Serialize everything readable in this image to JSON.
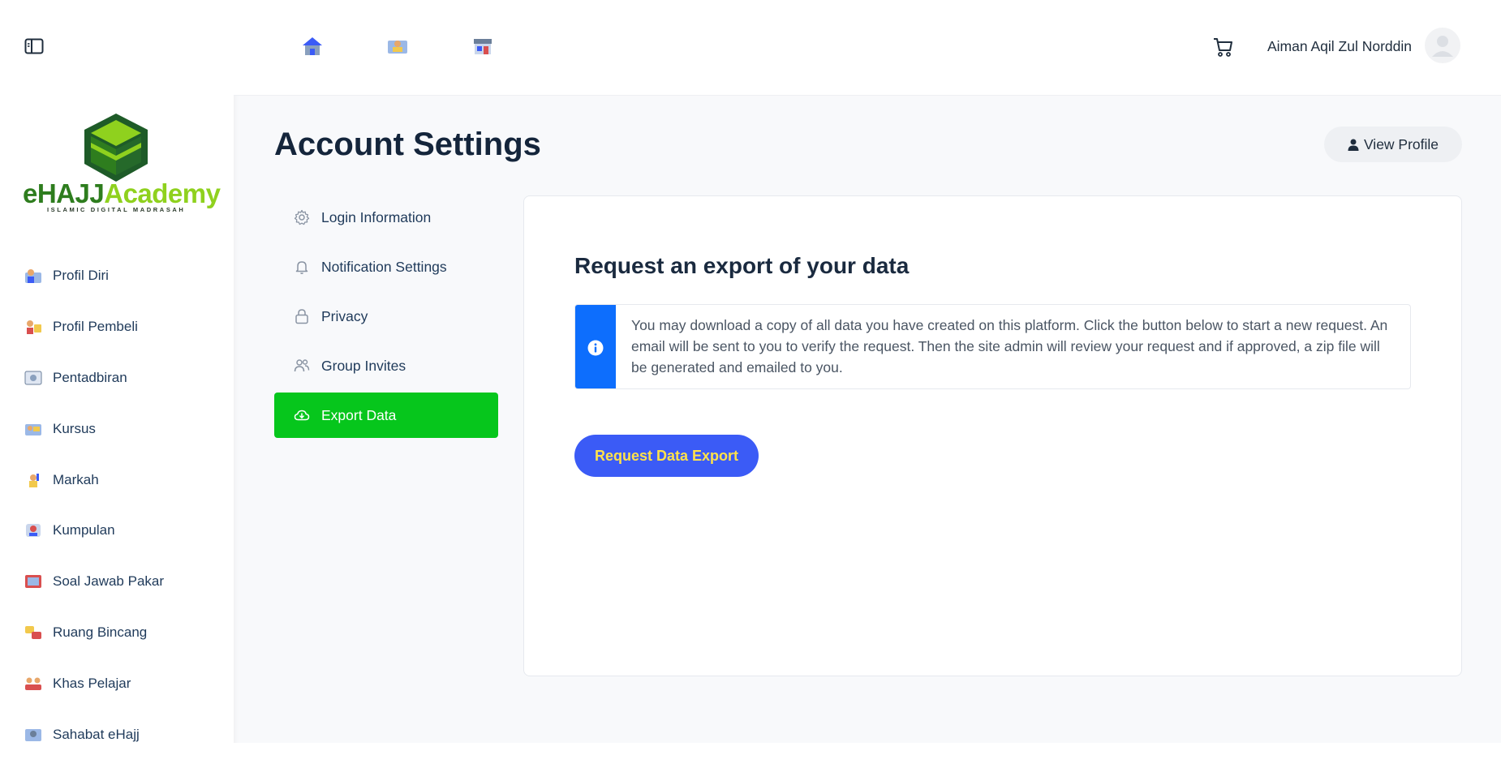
{
  "sidebar": {
    "logo": {
      "brand_part1": "eHAJJ",
      "brand_part2": "Academy",
      "tagline": "ISLAMIC DIGITAL MADRASAH"
    },
    "items": [
      {
        "label": "Profil Diri",
        "icon": "profile-person-icon"
      },
      {
        "label": "Profil Pembeli",
        "icon": "buyer-profile-icon"
      },
      {
        "label": "Pentadbiran",
        "icon": "administration-icon"
      },
      {
        "label": "Kursus",
        "icon": "course-icon"
      },
      {
        "label": "Markah",
        "icon": "marks-icon"
      },
      {
        "label": "Kumpulan",
        "icon": "group-icon"
      },
      {
        "label": "Soal Jawab Pakar",
        "icon": "expert-qa-icon"
      },
      {
        "label": "Ruang Bincang",
        "icon": "discussion-icon"
      },
      {
        "label": "Khas Pelajar",
        "icon": "students-icon"
      },
      {
        "label": "Sahabat eHajj",
        "icon": "friends-icon"
      }
    ]
  },
  "header": {
    "user_name": "Aiman Aqil Zul Norddin"
  },
  "main": {
    "title": "Account Settings",
    "view_profile_label": "View Profile",
    "settings_nav": [
      {
        "label": "Login Information",
        "icon": "gear-icon",
        "active": false
      },
      {
        "label": "Notification Settings",
        "icon": "bell-icon",
        "active": false
      },
      {
        "label": "Privacy",
        "icon": "lock-icon",
        "active": false
      },
      {
        "label": "Group Invites",
        "icon": "users-icon",
        "active": false
      },
      {
        "label": "Export Data",
        "icon": "cloud-download-icon",
        "active": true
      }
    ],
    "panel": {
      "title": "Request an export of your data",
      "notice": "You may download a copy of all data you have created on this platform. Click the button below to start a new request. An email will be sent to you to verify the request. Then the site admin will review your request and if approved, a zip file will be generated and emailed to you.",
      "button_label": "Request Data Export"
    }
  },
  "colors": {
    "active_nav": "#06c61c",
    "primary_button": "#3b5bf6",
    "primary_button_text": "#ffe24a",
    "info_bar": "#0d6efd"
  }
}
